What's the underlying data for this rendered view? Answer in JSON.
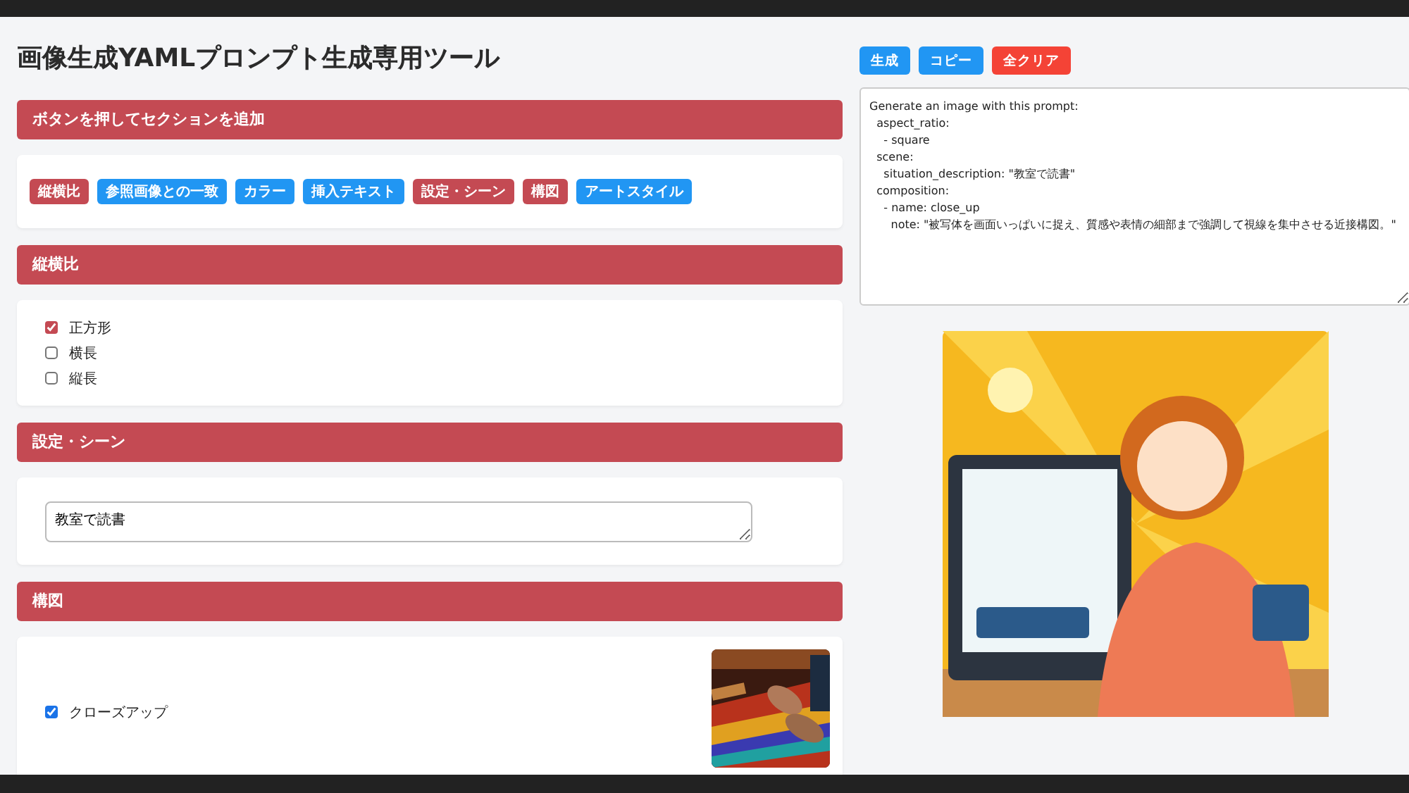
{
  "title": "画像生成YAMLプロンプト生成専用ツール",
  "add_panel": {
    "heading": "ボタンを押してセクションを追加",
    "buttons": [
      {
        "label": "縦横比",
        "added": true
      },
      {
        "label": "参照画像との一致",
        "added": false
      },
      {
        "label": "カラー",
        "added": false
      },
      {
        "label": "挿入テキスト",
        "added": false
      },
      {
        "label": "設定・シーン",
        "added": true
      },
      {
        "label": "構図",
        "added": true
      },
      {
        "label": "アートスタイル",
        "added": false
      }
    ]
  },
  "sections": [
    {
      "kind": "checkboxes",
      "heading": "縦横比",
      "options": [
        {
          "label": "正方形",
          "checked": true
        },
        {
          "label": "横長",
          "checked": false
        },
        {
          "label": "縦長",
          "checked": false
        }
      ]
    },
    {
      "kind": "textarea",
      "heading": "設定・シーン",
      "value": "教室で読書"
    },
    {
      "kind": "image_checkboxes",
      "heading": "構図",
      "options": [
        {
          "label": "クローズアップ",
          "checked": true
        }
      ]
    }
  ],
  "actions": [
    {
      "label": "生成",
      "kind": "primary"
    },
    {
      "label": "コピー",
      "kind": "primary"
    },
    {
      "label": "全クリア",
      "kind": "danger"
    }
  ],
  "output": {
    "value": "Generate an image with this prompt:\n  aspect_ratio:\n    - square\n  scene:\n    situation_description: \"教室で読書\"\n  composition:\n    - name: close_up\n      note: \"被写体を画面いっぱいに捉え、質感や表情の細部まで強調して視線を集中させる近接構図。\""
  }
}
